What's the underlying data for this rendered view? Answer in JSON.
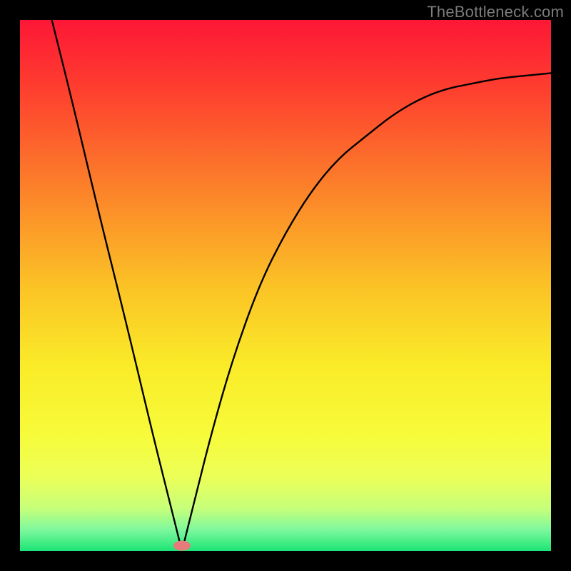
{
  "watermark": "TheBottleneck.com",
  "chart_data": {
    "type": "line",
    "title": "",
    "xlabel": "",
    "ylabel": "",
    "xlim": [
      0,
      1
    ],
    "ylim": [
      0,
      1
    ],
    "x_min_point": 0.305,
    "series": [
      {
        "name": "curve",
        "x": [
          0.06,
          0.1,
          0.15,
          0.2,
          0.25,
          0.28,
          0.3,
          0.305,
          0.31,
          0.33,
          0.36,
          0.4,
          0.45,
          0.5,
          0.55,
          0.6,
          0.65,
          0.7,
          0.75,
          0.8,
          0.85,
          0.9,
          0.95,
          1.0
        ],
        "y": [
          1.0,
          0.84,
          0.63,
          0.43,
          0.22,
          0.1,
          0.02,
          0.0,
          0.02,
          0.1,
          0.22,
          0.36,
          0.5,
          0.6,
          0.68,
          0.74,
          0.78,
          0.82,
          0.85,
          0.87,
          0.88,
          0.89,
          0.895,
          0.9
        ]
      }
    ],
    "gradient_stops": [
      {
        "offset": 0.0,
        "color": "#fd1736"
      },
      {
        "offset": 0.12,
        "color": "#fe3b2f"
      },
      {
        "offset": 0.3,
        "color": "#fc7b2a"
      },
      {
        "offset": 0.5,
        "color": "#fbc226"
      },
      {
        "offset": 0.65,
        "color": "#faeb28"
      },
      {
        "offset": 0.78,
        "color": "#f7fb3a"
      },
      {
        "offset": 0.86,
        "color": "#ecff57"
      },
      {
        "offset": 0.92,
        "color": "#c6ff7a"
      },
      {
        "offset": 0.96,
        "color": "#7ef89d"
      },
      {
        "offset": 1.0,
        "color": "#1be576"
      }
    ],
    "marker": {
      "x": 0.305,
      "y": 0.01,
      "color": "#e77a7a",
      "rx": 12,
      "ry": 7
    }
  }
}
